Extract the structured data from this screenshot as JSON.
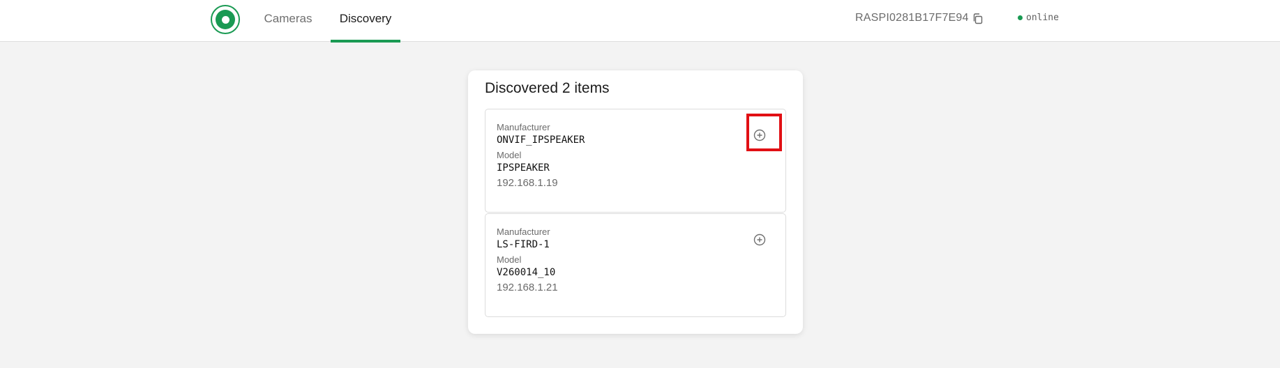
{
  "header": {
    "nav": [
      {
        "label": "Cameras"
      },
      {
        "label": "Discovery"
      }
    ],
    "device_id": "RASPI0281B17F7E94",
    "status": "online",
    "colors": {
      "accent": "#1a9a53",
      "highlight": "#e10f14"
    },
    "icons": {
      "logo": "logo-icon",
      "copy": "copy-icon"
    }
  },
  "discovery": {
    "title": "Discovered 2 items",
    "items": [
      {
        "manufacturer_label": "Manufacturer",
        "manufacturer": "ONVIF_IPSPEAKER",
        "model_label": "Model",
        "model": "IPSPEAKER",
        "ip": "192.168.1.19",
        "action_icon": "add-circle-icon"
      },
      {
        "manufacturer_label": "Manufacturer",
        "manufacturer": "LS-FIRD-1",
        "model_label": "Model",
        "model": "V260014_10",
        "ip": "192.168.1.21",
        "action_icon": "add-circle-icon"
      }
    ]
  }
}
